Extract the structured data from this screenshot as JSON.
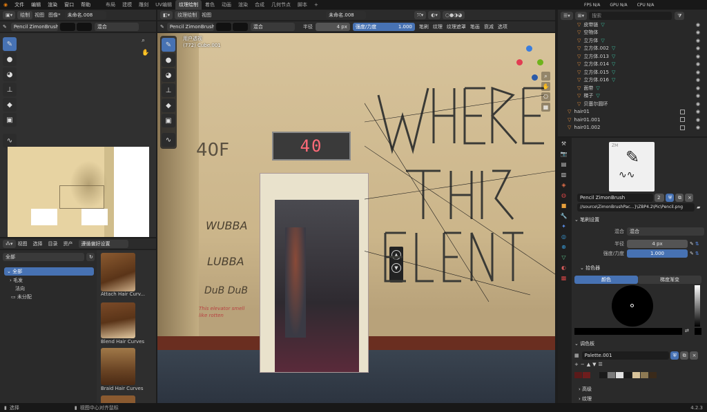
{
  "topbar": {
    "menus": [
      "文件",
      "编辑",
      "渲染",
      "窗口",
      "帮助"
    ],
    "tabs": [
      "布局",
      "建模",
      "雕刻",
      "UV编辑",
      "纹理绘制",
      "着色",
      "动画",
      "渲染",
      "合成",
      "几何节点",
      "脚本"
    ],
    "active_tab": "纹理绘制",
    "add_tab": "+",
    "fps": "FPS N/A",
    "gpu": "GPU N/A",
    "cpu": "CPU N/A",
    "scene_label": "Scene",
    "viewlayer_label": "ViewLayer"
  },
  "left_header": {
    "mode": "绘制",
    "view": "视图",
    "image": "图像*",
    "image_name": "未命名.008"
  },
  "left_tool_header": {
    "brush": "Pencil ZimonBrush",
    "blend": "混合"
  },
  "viewport_header": {
    "mode": "纹理绘制",
    "menus": [
      "视图"
    ],
    "image_name": "未命名.008",
    "brush": "Pencil ZimonBrush",
    "blend": "混合",
    "radius_label": "半径",
    "radius_value": "4 px",
    "strength_label": "强度/力度",
    "strength_value": "1.000",
    "menus2": [
      "笔刷",
      "纹理",
      "纹理遮罩",
      "笔画",
      "衰减",
      "选项"
    ]
  },
  "viewport": {
    "perspective": "用户透视",
    "object_info": "(772) Cube.001",
    "elevator_display": "40",
    "floor_label": "40F",
    "graffiti": [
      "WUBBA",
      "LUBBA",
      "DuB DuB"
    ],
    "note": "This elevator smell like rotten"
  },
  "asset_browser": {
    "menus": [
      "视图",
      "选择",
      "目录",
      "资产"
    ],
    "library": "遵循偏好设置",
    "filter": "全部",
    "tree": [
      {
        "label": "全部",
        "selected": true
      },
      {
        "label": "毛发",
        "selected": false
      },
      {
        "label": "法向",
        "selected": false
      },
      {
        "label": "未分配",
        "selected": false
      }
    ],
    "assets": [
      "Attach Hair Curv...",
      "Blend Hair Curves",
      "Braid Hair Curves"
    ]
  },
  "outliner": {
    "search_placeholder": "搜索",
    "rows": [
      "皮带链",
      "空物体",
      "立方体",
      "立方体.002",
      "立方体.013",
      "立方体.014",
      "立方体.015",
      "立方体.016",
      "面带",
      "梯子",
      "贝塞尔圆环",
      "hair01",
      "hair01.001",
      "hair01.002"
    ]
  },
  "properties": {
    "brush_name": "Pencil ZimonBrush",
    "brush_users": "2",
    "brush_path": "//source\\ZimonBrushPac...}\\ZBP4.2\\Pic\\Pencil.png",
    "brush_settings": "笔刷设置",
    "blend_label": "混合",
    "blend_value": "混合",
    "radius_label": "半径",
    "radius_value": "4 px",
    "strength_label": "强度/力度",
    "strength_value": "1.000",
    "color_picker": "拾色器",
    "color_tab": "颜色",
    "gradient_tab": "梯度渐变",
    "palette_section": "调色板",
    "palette_name": "Palette.001",
    "palette_colors": [
      "#5a1a1a",
      "#6e1d1d",
      "#2a2a2a",
      "#1a1a1a",
      "#7a7a7a",
      "#e0e0e0",
      "#1a1a1a",
      "#d8c39a",
      "#8e7a54",
      "#3a2a1a"
    ],
    "advanced": "高级",
    "texture": "纹理"
  },
  "statusbar": {
    "select": "选择",
    "center": "视图中心对齐鼠标",
    "version": "4.2.3"
  }
}
